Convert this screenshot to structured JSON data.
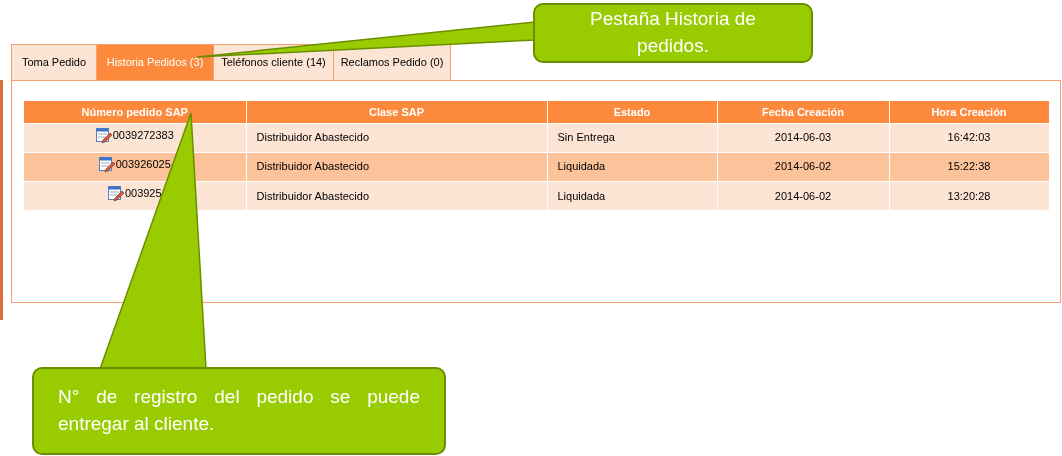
{
  "tabs": [
    {
      "label": "Toma Pedido",
      "selected": false
    },
    {
      "label": "Historia Pedidos (3)",
      "selected": true
    },
    {
      "label": "Teléfonos cliente (14)",
      "selected": false
    },
    {
      "label": "Reclamos Pedido (0)",
      "selected": false
    }
  ],
  "table": {
    "columns": [
      "Número pedido SAP",
      "Clase SAP",
      "Estado",
      "Fecha Creación",
      "Hora Creación"
    ],
    "rows": [
      {
        "cells": [
          "0039272383",
          "Distribuidor Abastecido",
          "Sin Entrega",
          "2014-06-03",
          "16:42:03"
        ]
      },
      {
        "cells": [
          "003926025",
          "Distribuidor Abastecido",
          "Liquidada",
          "2014-06-02",
          "15:22:38"
        ]
      },
      {
        "cells": [
          "003925",
          "Distribuidor Abastecido",
          "Liquidada",
          "2014-06-02",
          "13:20:28"
        ]
      }
    ]
  },
  "callouts": [
    {
      "text": "Pestaña Historia de pedidos.",
      "kind": "center"
    },
    {
      "text": "N° de registro del pedido se puede entregar al cliente.",
      "kind": "justify"
    }
  ]
}
